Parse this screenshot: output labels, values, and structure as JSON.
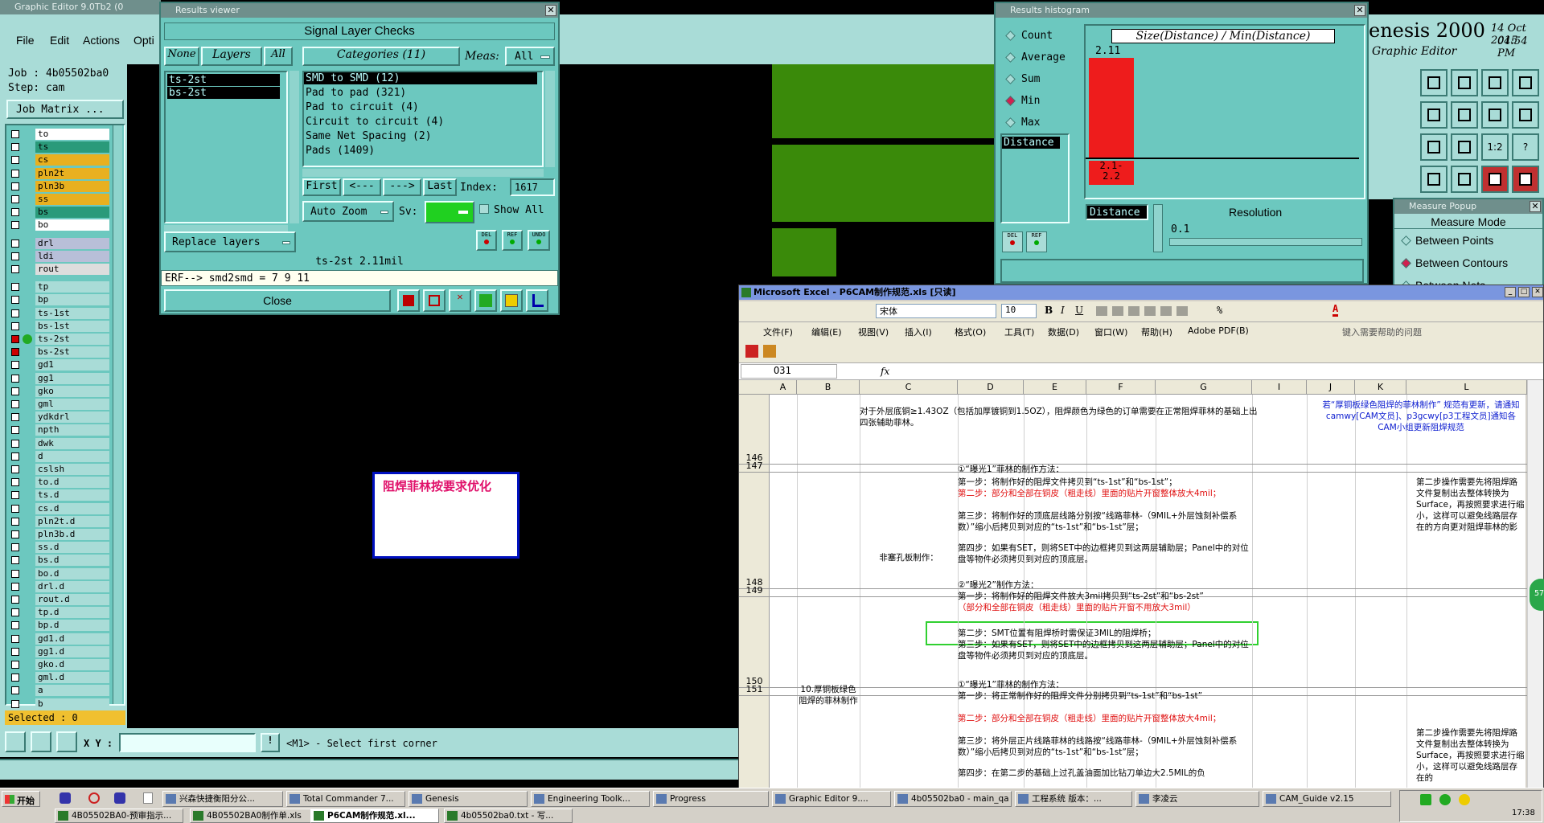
{
  "main_window": {
    "title": "Graphic Editor 9.0Tb2 (0",
    "menu": [
      "File",
      "Edit",
      "Actions",
      "Opti"
    ],
    "job_label": "Job : 4b05502ba0",
    "step_label": "Step: cam",
    "job_matrix_btn": "Job Matrix ...",
    "selected_label": "Selected : 0",
    "xy_label": "X Y :",
    "status_msg": "<M1> - Select first corner"
  },
  "layers": [
    "to",
    "ts",
    "cs",
    "pln2t",
    "pln3b",
    "ss",
    "bs",
    "bo",
    "drl",
    "ldi",
    "rout",
    "tp",
    "bp",
    "ts-1st",
    "bs-1st",
    "ts-2st",
    "bs-2st",
    "gd1",
    "gg1",
    "gko",
    "gml",
    "ydkdrl",
    "npth",
    "dwk",
    "d",
    "cslsh",
    "to.d",
    "ts.d",
    "cs.d",
    "pln2t.d",
    "pln3b.d",
    "ss.d",
    "bs.d",
    "bo.d",
    "drl.d",
    "rout.d",
    "tp.d",
    "bp.d",
    "gd1.d",
    "gg1.d",
    "gko.d",
    "gml.d",
    "a",
    "b"
  ],
  "results_viewer": {
    "title": "Results viewer",
    "header": "Signal Layer Checks",
    "none_btn": "None",
    "layers_label": "Layers",
    "all_btn": "All",
    "categories_label": "Categories (11)",
    "meas_label": "Meas:",
    "meas_value": "All",
    "layer_items": [
      "ts-2st",
      "bs-2st"
    ],
    "categories": [
      "SMD to SMD (12)",
      "Pad to pad (321)",
      "Pad to circuit (4)",
      "Circuit to circuit (4)",
      "Same Net Spacing (2)",
      "Pads (1409)"
    ],
    "nav": {
      "first": "First",
      "prev": "<---",
      "next": "--->",
      "last": "Last",
      "index_label": "Index:",
      "index_value": "1617"
    },
    "auto_zoom": "Auto Zoom",
    "sv_label": "Sv:",
    "show_all": "Show All",
    "replace_layers": "Replace layers",
    "del": "DEL",
    "ref": "REF",
    "undo": "UNDO",
    "status_line": "ts-2st 2.11mil",
    "erf_line": "ERF--> smd2smd = 7 9 11",
    "close": "Close"
  },
  "histogram": {
    "title": "Results histogram",
    "options": [
      "Count",
      "Average",
      "Sum",
      "Min",
      "Max"
    ],
    "selected_option": "Min",
    "chart_title": "Size(Distance) / Min(Distance)",
    "top_value": "2.11",
    "bar_label": "2.1-\n2.2",
    "distance_list_item": "Distance",
    "distance_field": "Distance",
    "resolution_label": "Resolution",
    "resolution_value": "0.1",
    "del": "DEL",
    "ref": "REF",
    "chart_data": {
      "type": "bar",
      "categories": [
        "2.1-2.2"
      ],
      "values": [
        1
      ],
      "title": "Size(Distance) / Min(Distance)"
    }
  },
  "genesis_panel": {
    "brand": "enesis 2000",
    "subtitle": "Graphic Editor",
    "date": "14 Oct 2015",
    "time": "04:54 PM",
    "icon_12": "1:2",
    "icon_help": "?"
  },
  "measure_popup": {
    "title": "Measure Popup",
    "header": "Measure Mode",
    "options": [
      "Between Points",
      "Between Contours",
      "Between Nets"
    ],
    "selected": "Between Contours"
  },
  "note_box": {
    "text": "阻焊菲林按要求优化"
  },
  "excel": {
    "title": "Microsoft Excel - P6CAM制作规范.xls [只读]",
    "font_name": "宋体",
    "font_size": "10",
    "menu": [
      "文件(F)",
      "编辑(E)",
      "视图(V)",
      "插入(I)",
      "格式(O)",
      "工具(T)",
      "数据(D)",
      "窗口(W)",
      "帮助(H)",
      "Adobe PDF(B)"
    ],
    "help_placeholder": "键入需要帮助的问题",
    "name_box": "O31",
    "fx": "fx",
    "columns": [
      "A",
      "B",
      "C",
      "D",
      "E",
      "F",
      "G",
      "I",
      "J",
      "K",
      "L"
    ],
    "row_numbers": [
      "146",
      "147",
      "148",
      "149",
      "150",
      "151"
    ],
    "r146_c": "对于外层底铜≥1.43OZ（包括加厚镀铜到1.5OZ），阻焊颜色为绿色的订单需要在正常阻焊菲林的基础上出四张辅助菲林。",
    "r146_j": "若“厚铜板绿色阻焊的菲林制作” 规范有更新，请通知camwy[CAM文员]、p3gcwy[p3工程文员]通知各CAM小组更新阻焊规范",
    "r147_d": "①“曝光1”菲林的制作方法：",
    "r148_d1": "第一步：将制作好的阻焊文件拷贝到“ts-1st”和“bs-1st”；",
    "r148_d2": "第二步：部分和全部在铜皮（粗走线）里面的贴片开窗整体放大4mil；",
    "r148_d3": "第三步：将制作好的顶底层线路分别按“线路菲林-（9MIL+外层蚀刻补偿系数）”缩小后拷贝到对应的“ts-1st”和“bs-1st”层；",
    "r148_d4": "第四步：如果有SET，则将SET中的边框拷贝到这两层辅助层；Panel中的对位盘等物件必须拷贝到对应的顶底层。",
    "r148_c": "非塞孔板制作：",
    "r148_l": "第二步操作需要先将阻焊路文件复制出去整体转换为Surface，再按照要求进行缩小，这样可以避免线路层存在的方向更对阻焊菲林的影",
    "r149_d": "②“曝光2”制作方法：",
    "r150_d1": "第一步：将制作好的阻焊文件放大3mil拷贝到“ts-2st”和“bs-2st”",
    "r150_d1r": "（部分和全部在铜皮（粗走线）里面的贴片开窗不用放大3mil）",
    "r150_d2": "第二步：SMT位置有阻焊桥时需保证3MIL的阻焊桥；",
    "r150_d3": "第三步：如果有SET，则将SET中的边框拷贝到这两层辅助层；Panel中的对位盘等物件必须拷贝到对应的顶底层。",
    "r151_b": "10.厚铜板绿色阻焊的菲林制作",
    "r151_d": "①“曝光1”菲林的制作方法：",
    "r152_d1": "第一步：将正常制作好的阻焊文件分别拷贝到“ts-1st”和“bs-1st”",
    "r152_d2": "第二步：部分和全部在铜皮（粗走线）里面的贴片开窗整体放大4mil；",
    "r152_d3": "第三步：将外层正片线路菲林的线路按“线路菲林-（9MIL+外层蚀刻补偿系数）”缩小后拷贝到对应的“ts-1st”和“bs-1st”层；",
    "r152_d4": "第四步：在第二步的基础上过孔盖油面加比钻刀单边大2.5MIL的负",
    "r152_l": "第二步操作需要先将阻焊路文件复制出去整体转换为Surface，再按照要求进行缩小，这样可以避免线路层存在的"
  },
  "taskbar": {
    "start": "开始",
    "row1": [
      "兴森快捷衡阳分公...",
      "Total Commander 7...",
      "Genesis",
      "Engineering Toolk...",
      "Progress",
      "Graphic Editor 9....",
      "4b05502ba0 - main_qa",
      "工程系统   版本：...",
      "李凌云",
      "CAM_Guide v2.15"
    ],
    "row2": [
      "4B05502BA0-预审指示...",
      "4B05502BA0制作单.xls",
      "P6CAM制作规范.xl...",
      "4b05502ba0.txt - 写..."
    ],
    "clock": "17:38",
    "side_badge": "57"
  }
}
